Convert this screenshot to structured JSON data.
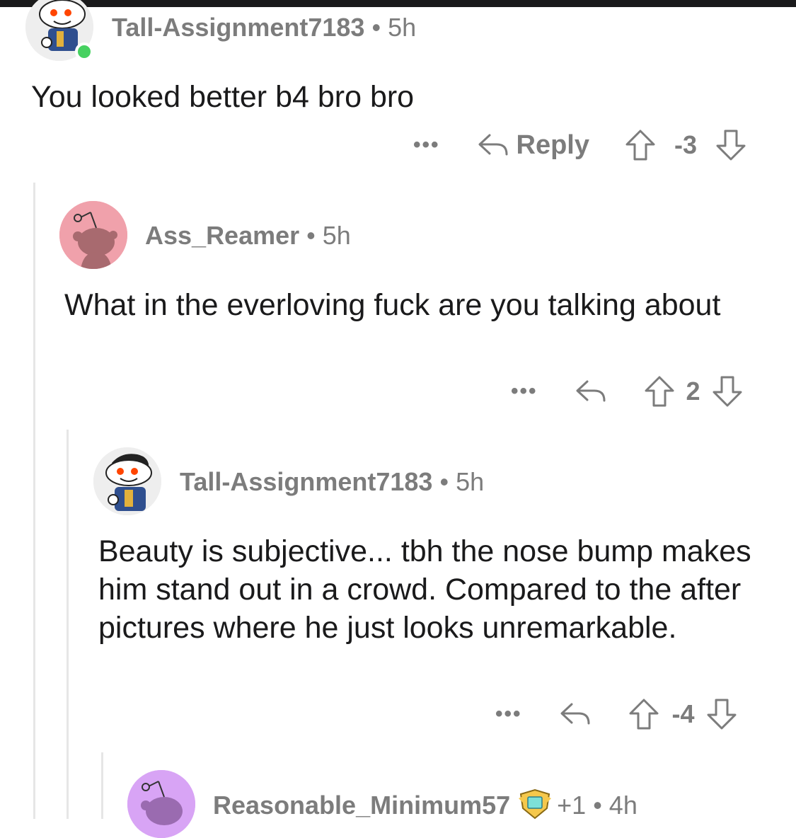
{
  "comments": [
    {
      "username": "Tall-Assignment7183",
      "time": "5h",
      "text": "You looked better b4 bro bro",
      "more": "•••",
      "reply_label": "Reply",
      "score": "-3",
      "online": true
    },
    {
      "username": "Ass_Reamer",
      "time": "5h",
      "text": "What in the everloving fuck are you talking about",
      "more": "•••",
      "score": "2"
    },
    {
      "username": "Tall-Assignment7183",
      "time": "5h",
      "text": "Beauty is subjective... tbh the nose bump makes him stand out in a crowd. Compared to the after pictures where he just looks unremarkable.",
      "more": "•••",
      "score": "-4"
    },
    {
      "username": "Reasonable_Minimum57",
      "time": "4h",
      "award_count": "+1"
    }
  ],
  "separator": "•",
  "colors": {
    "meta_gray": "#7c7c7c",
    "thread_line": "#e6e6e6",
    "online": "#46d160",
    "avatar_pink": "#f0a1ab",
    "avatar_purple": "#d8a4f5"
  }
}
